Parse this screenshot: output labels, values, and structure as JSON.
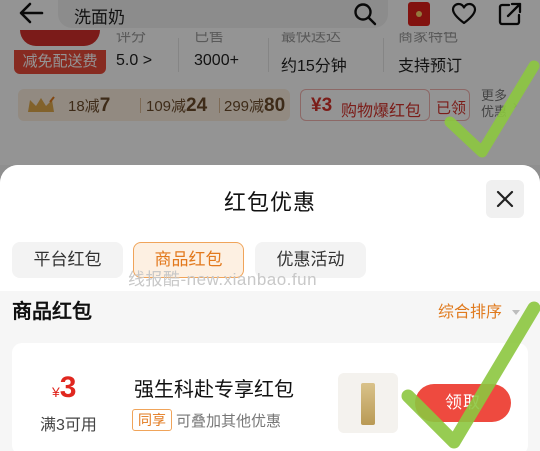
{
  "header": {
    "search_text": "洗面奶",
    "icons": [
      "back-arrow-icon",
      "search-icon",
      "red-packet-icon",
      "heart-icon",
      "share-icon"
    ]
  },
  "store": {
    "logo_band": "减免配送费",
    "stats": [
      {
        "label": "评分",
        "value": "5.0 >"
      },
      {
        "label": "已售",
        "value": "3000+"
      },
      {
        "label": "最快送达",
        "value": "约15分钟"
      },
      {
        "label": "商家特色",
        "value": "支持预订"
      }
    ],
    "coupons": [
      {
        "text": "18减",
        "amount": "7"
      },
      {
        "text": "109减",
        "amount": "24"
      },
      {
        "text": "299减",
        "amount": "80"
      }
    ],
    "hongbao": {
      "yen": "¥3",
      "label": "购物爆红包",
      "claimed": "已领"
    },
    "more_offers": "更多优惠"
  },
  "sheet": {
    "title": "红包优惠",
    "tabs": [
      {
        "label": "平台红包",
        "active": false
      },
      {
        "label": "商品红包",
        "active": true
      },
      {
        "label": "优惠活动",
        "active": false
      }
    ],
    "watermark": "线报酷-new.xianbao.fun",
    "section_title": "商品红包",
    "sort_label": "综合排序",
    "coupon": {
      "currency": "¥",
      "amount": "3",
      "condition": "满3可用",
      "name": "强生科赴专享红包",
      "share_tag": "同享",
      "stack_note": "可叠加其他优惠",
      "claim_label": "领取"
    }
  },
  "colors": {
    "accent_orange": "#e2791d",
    "accent_red": "#ee4a3f",
    "price_red": "#e0271f",
    "check_green": "#8cc63f"
  }
}
